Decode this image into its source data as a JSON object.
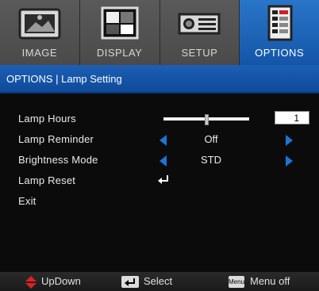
{
  "tabs": [
    {
      "label": "IMAGE",
      "icon": "image-icon"
    },
    {
      "label": "DISPLAY",
      "icon": "display-icon"
    },
    {
      "label": "SETUP",
      "icon": "projector-icon"
    },
    {
      "label": "OPTIONS",
      "icon": "options-icon",
      "active": true
    }
  ],
  "breadcrumb": "OPTIONS | Lamp Setting",
  "menu": {
    "lamp_hours": {
      "label": "Lamp Hours",
      "value": "1",
      "slider_level": 0.5
    },
    "lamp_reminder": {
      "label": "Lamp Reminder",
      "value": "Off"
    },
    "brightness_mode": {
      "label": "Brightness Mode",
      "value": "STD"
    },
    "lamp_reset": {
      "label": "Lamp Reset"
    },
    "exit": {
      "label": "Exit"
    }
  },
  "footer": {
    "updown": "UpDown",
    "select": "Select",
    "menu_key": "Menu",
    "menu_off": "Menu off"
  },
  "colors": {
    "active_tab": "#1c5fb5",
    "arrow": "#1c74d8",
    "updown_icon": "#e02020"
  }
}
